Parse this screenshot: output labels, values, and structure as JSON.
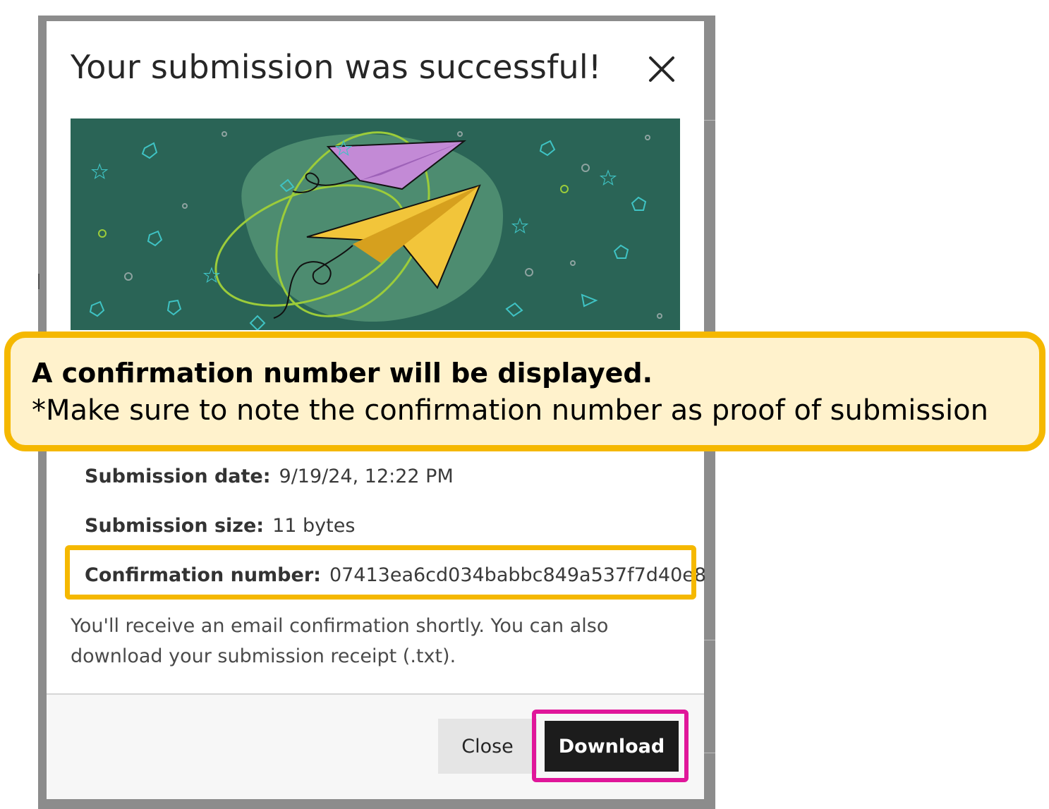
{
  "modal": {
    "title": "Your submission was successful!",
    "close_icon": "close-icon"
  },
  "details": {
    "date_label": "Submission date:",
    "date_value": "9/19/24, 12:22 PM",
    "size_label": "Submission size:",
    "size_value": "11 bytes",
    "confirmation_label": "Confirmation number:",
    "confirmation_value": "07413ea6cd034babbc849a537f7d40e8"
  },
  "email_note": "You'll receive an email confirmation shortly. You can also download your submission receipt (.txt).",
  "buttons": {
    "close_label": "Close",
    "download_label": "Download"
  },
  "callout": {
    "title": "A confirmation number will be displayed.",
    "subtitle": "*Make sure to note the confirmation number as proof of submission"
  },
  "colors": {
    "callout_border": "#f5b800",
    "callout_fill": "#fff2cc",
    "download_highlight": "#e0169a",
    "illustration_bg": "#2a6456",
    "download_button": "#1c1c1c"
  }
}
